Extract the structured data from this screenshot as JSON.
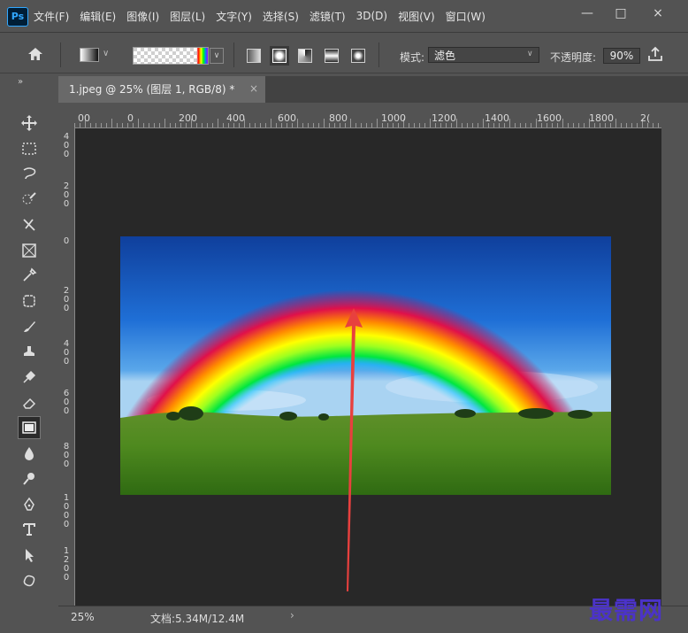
{
  "app": {
    "logo": "Ps"
  },
  "menu": [
    "文件(F)",
    "编辑(E)",
    "图像(I)",
    "图层(L)",
    "文字(Y)",
    "选择(S)",
    "滤镜(T)",
    "3D(D)",
    "视图(V)",
    "窗口(W)"
  ],
  "window_controls": {
    "minimize": "—",
    "maximize": "□",
    "close": "×"
  },
  "options": {
    "mode_label": "模式:",
    "mode_value": "滤色",
    "opacity_label": "不透明度:",
    "opacity_value": "90%"
  },
  "collapse_label": "»",
  "document_tab": {
    "title": "1.jpeg @ 25% (图层 1, RGB/8) *",
    "close": "×"
  },
  "ruler_h": [
    "00",
    "0",
    "200",
    "400",
    "600",
    "800",
    "1000",
    "1200",
    "1400",
    "1600",
    "1800",
    "2("
  ],
  "ruler_v": [
    "4 0 0",
    "2 0 0",
    "0",
    "2 0 0",
    "4 0 0",
    "6 0 0",
    "8 0 0",
    "1 0 0 0",
    "1 2 0 0"
  ],
  "tools": [
    "move-tool",
    "marquee-tool",
    "lasso-tool",
    "quick-select-tool",
    "crop-tool",
    "frame-tool",
    "eyedropper-tool",
    "healing-tool",
    "brush-tool",
    "stamp-tool",
    "history-brush-tool",
    "eraser-tool",
    "gradient-tool",
    "blur-tool",
    "dodge-tool",
    "pen-tool",
    "type-tool",
    "path-select-tool",
    "shape-tool"
  ],
  "status": {
    "zoom": "25%",
    "doc_size": "文档:5.34M/12.4M",
    "arrow": "›"
  },
  "watermark": "最需网",
  "colors": {
    "accent": "#31a8ff",
    "annotation_arrow": "#e8403e",
    "watermark": "#4b33c9"
  }
}
